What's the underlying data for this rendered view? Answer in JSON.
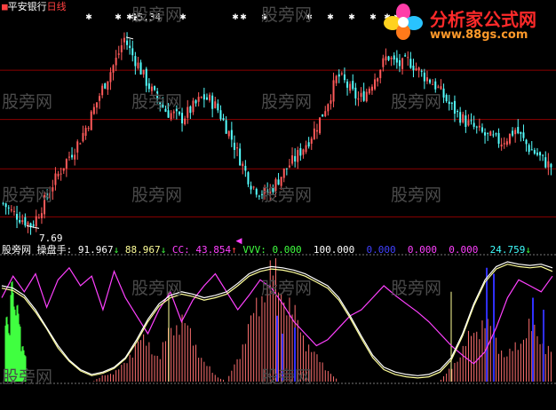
{
  "header": {
    "square": "■",
    "stock": "平安银行",
    "period": "日线"
  },
  "price_labels": {
    "high": "15.34",
    "low": "7.69"
  },
  "indicator": {
    "site": "股旁网",
    "name": "操盘手:",
    "v1": "91.967",
    "v1_arrow": "↓",
    "v2": "88.967",
    "v2_arrow": "↓",
    "cc_label": "CC:",
    "cc": "43.854",
    "cc_arrow": "↑",
    "vvv_label": "VVV:",
    "vvv": "0.000",
    "v4": "100.000",
    "v5": "0.000",
    "v6": "0.000",
    "v7": "0.000",
    "v8": "24.759",
    "v8_arrow": "↓"
  },
  "watermark": "股旁网",
  "logo": {
    "title": "分析家公式网",
    "url": "www.88gs.com"
  },
  "colors": {
    "bg": "#000000",
    "up": "#ff5a5a",
    "down": "#54ffff",
    "grid": "#8b0000",
    "yellow": "#ffff99",
    "white": "#ffffff",
    "magenta": "#ff40ff",
    "green": "#40ff40",
    "blue": "#3030ff",
    "pink": "#ff7070",
    "red": "#ff3030"
  },
  "chart_data": [
    {
      "type": "candlestick",
      "price_range": [
        7.2,
        16.2
      ],
      "annotated_high": 15.34,
      "annotated_low": 7.69,
      "close_path": [
        8.6,
        8.3,
        8.1,
        7.9,
        7.7,
        8.2,
        8.8,
        9.4,
        9.9,
        10.4,
        10.8,
        11.3,
        11.9,
        12.6,
        13.3,
        13.9,
        14.5,
        15.3,
        14.7,
        14.2,
        13.6,
        13.1,
        12.7,
        12.3,
        12.2,
        12.0,
        12.3,
        12.6,
        12.9,
        12.8,
        12.5,
        11.9,
        11.3,
        10.6,
        9.9,
        9.3,
        9.1,
        9.0,
        9.3,
        9.7,
        10.1,
        10.4,
        10.8,
        11.2,
        11.7,
        12.3,
        13.0,
        13.8,
        13.5,
        13.1,
        12.8,
        13.1,
        13.6,
        14.1,
        14.6,
        14.3,
        14.2,
        14.4,
        14.1,
        13.8,
        13.6,
        13.3,
        12.9,
        12.5,
        12.2,
        11.9,
        11.7,
        11.5,
        11.3,
        11.2,
        11.1,
        11.3,
        11.6,
        11.2,
        10.8,
        10.6,
        10.3,
        10.1
      ],
      "star_markers": 14
    },
    {
      "type": "indicator",
      "range": [
        0,
        100
      ],
      "white": [
        80,
        78,
        72,
        60,
        45,
        30,
        18,
        10,
        6,
        8,
        12,
        20,
        35,
        52,
        65,
        72,
        75,
        73,
        70,
        72,
        75,
        82,
        90,
        94,
        96,
        95,
        93,
        90,
        85,
        80,
        70,
        55,
        38,
        22,
        12,
        8,
        6,
        5,
        6,
        10,
        20,
        40,
        65,
        85,
        96,
        100,
        98,
        97,
        98,
        95
      ],
      "yellow": [
        78,
        76,
        70,
        58,
        44,
        28,
        17,
        9,
        5,
        7,
        11,
        19,
        33,
        50,
        63,
        70,
        73,
        71,
        68,
        70,
        73,
        80,
        88,
        92,
        94,
        93,
        91,
        88,
        83,
        78,
        68,
        53,
        36,
        20,
        10,
        6,
        4,
        3,
        4,
        8,
        18,
        38,
        63,
        83,
        94,
        98,
        96,
        95,
        96,
        92
      ],
      "magenta": [
        70,
        88,
        75,
        90,
        62,
        85,
        95,
        80,
        88,
        60,
        92,
        70,
        55,
        40,
        60,
        75,
        50,
        68,
        80,
        90,
        75,
        60,
        72,
        85,
        78,
        65,
        50,
        40,
        30,
        35,
        45,
        55,
        60,
        70,
        80,
        72,
        65,
        58,
        50,
        40,
        30,
        22,
        15,
        25,
        45,
        70,
        85,
        80,
        75,
        88
      ],
      "bars": [
        0,
        0,
        0,
        0,
        0,
        0,
        0,
        0,
        0,
        5,
        8,
        15,
        35,
        30,
        20,
        45,
        50,
        35,
        15,
        5,
        0,
        20,
        45,
        70,
        90,
        75,
        55,
        35,
        20,
        10,
        0,
        0,
        0,
        0,
        0,
        0,
        0,
        0,
        0,
        0,
        10,
        25,
        40,
        50,
        35,
        20,
        30,
        45,
        35,
        25
      ],
      "green_spike": [
        0.55,
        0.85,
        0.65,
        0.3
      ]
    }
  ]
}
